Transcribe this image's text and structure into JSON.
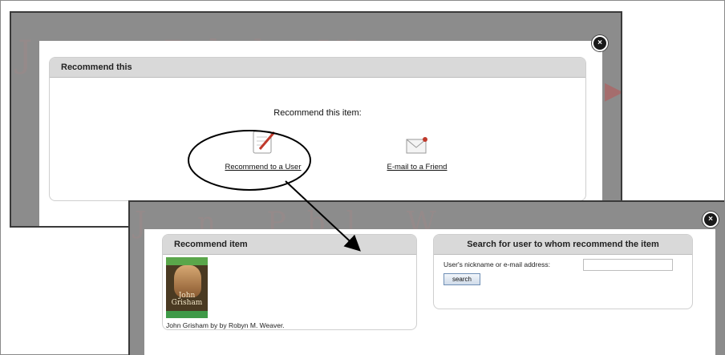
{
  "screen_one": {
    "dialog_title": "Recommend this",
    "prompt": "Recommend this item:",
    "option_user_label": "Recommend to a User",
    "option_email_label": "E-mail to a Friend",
    "close_glyph": "×",
    "option_user_icon": "document-pencil-icon",
    "option_email_icon": "envelope-icon"
  },
  "screen_two": {
    "left_panel_title": "Recommend item",
    "cover_text": "John Grisham",
    "book_caption": "John Grisham by by Robyn M. Weaver.",
    "right_panel_title": "Search for user to whom recommend the item",
    "field_label": "User's nickname or e-mail address:",
    "field_value": "",
    "search_button_label": "search",
    "close_glyph": "×"
  },
  "colors": {
    "overlay_gray": "#8c8c8c",
    "panel_header": "#d9d9d9",
    "accent_red": "#c0392b"
  }
}
